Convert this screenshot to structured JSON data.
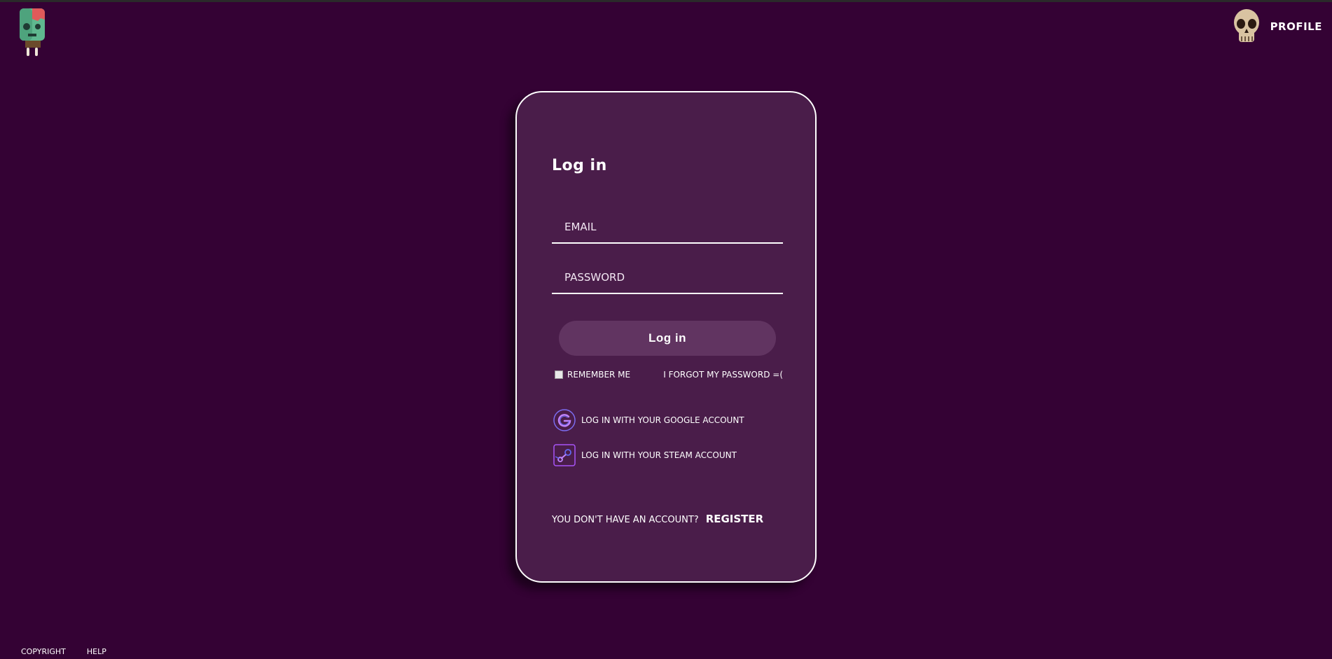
{
  "header": {
    "profile_label": "PROFILE",
    "logo_icon": "zombie-popsicle-icon",
    "profile_icon": "skull-icon"
  },
  "login": {
    "title": "Log in",
    "email_placeholder": "Email",
    "password_placeholder": "Password",
    "submit_label": "Log in",
    "remember_label": "Remember me",
    "remember_checked": false,
    "forgot_label": "I forgot my password =(",
    "google_label": "Log in with your google account",
    "steam_label": "Log in with your Steam account",
    "no_account_text": "You don't have an account?",
    "register_label": "Register"
  },
  "footer": {
    "copyright_label": "Copyright",
    "help_label": "Help"
  },
  "colors": {
    "background": "#340234",
    "card": "#4a1d4a",
    "button": "#613461",
    "accent": "#a855f7"
  }
}
